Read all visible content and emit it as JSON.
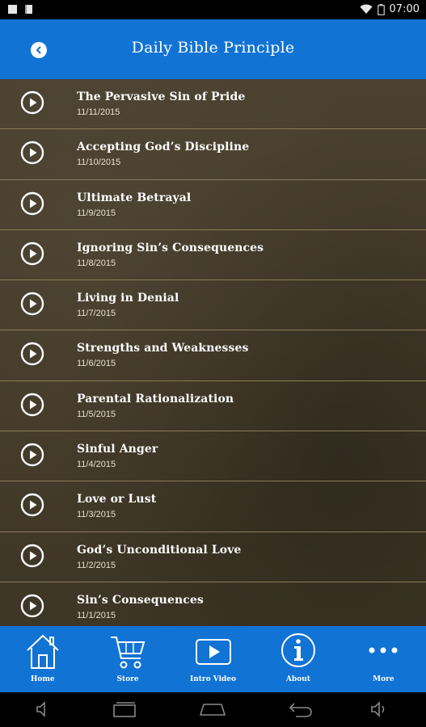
{
  "status_bar": {
    "time": "07:00"
  },
  "header": {
    "title": "Daily Bible Principle"
  },
  "items": [
    {
      "title": "The Pervasive Sin of Pride",
      "date": "11/11/2015"
    },
    {
      "title": "Accepting God’s Discipline",
      "date": "11/10/2015"
    },
    {
      "title": "Ultimate Betrayal",
      "date": "11/9/2015"
    },
    {
      "title": "Ignoring Sin’s Consequences",
      "date": "11/8/2015"
    },
    {
      "title": "Living in Denial",
      "date": "11/7/2015"
    },
    {
      "title": "Strengths and Weaknesses",
      "date": "11/6/2015"
    },
    {
      "title": "Parental Rationalization",
      "date": "11/5/2015"
    },
    {
      "title": "Sinful Anger",
      "date": "11/4/2015"
    },
    {
      "title": "Love or Lust",
      "date": "11/3/2015"
    },
    {
      "title": "God’s Unconditional Love",
      "date": "11/2/2015"
    },
    {
      "title": "Sin’s Consequences",
      "date": "11/1/2015"
    }
  ],
  "tabs": [
    {
      "label": "Home",
      "icon": "home-icon"
    },
    {
      "label": "Store",
      "icon": "cart-icon"
    },
    {
      "label": "Intro Video",
      "icon": "video-play-icon"
    },
    {
      "label": "About",
      "icon": "info-icon"
    },
    {
      "label": "More",
      "icon": "more-dots-icon"
    }
  ],
  "colors": {
    "accent": "#1173d4",
    "list_bg": "#433a2a",
    "divider": "#8a7d55"
  }
}
